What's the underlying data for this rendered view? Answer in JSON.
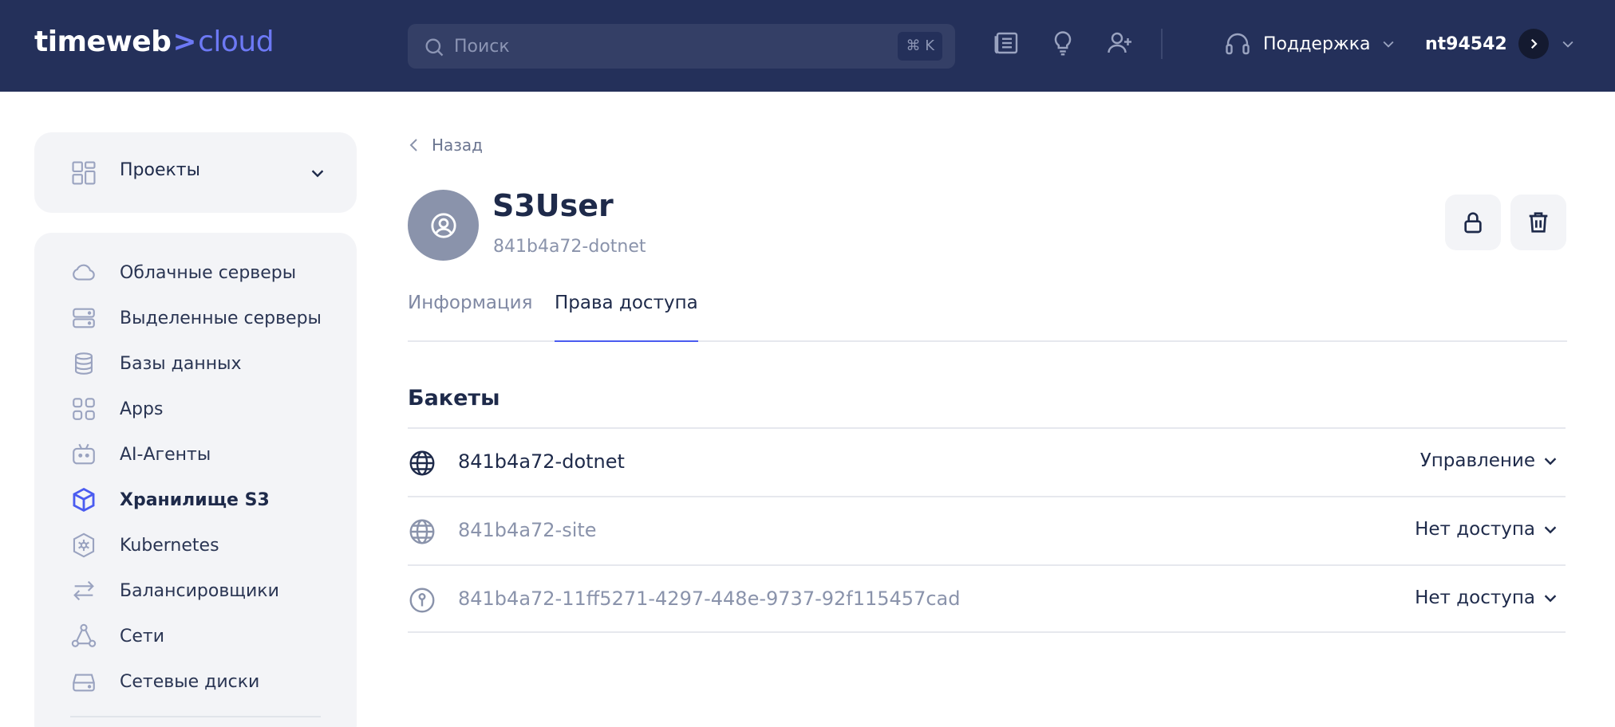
{
  "header": {
    "logo_main": "timeweb",
    "logo_chevron": ">",
    "logo_accent": "cloud",
    "search_placeholder": "Поиск",
    "search_shortcut": "⌘ K",
    "support_label": "Поддержка",
    "username": "nt94542"
  },
  "sidebar": {
    "projects_label": "Проекты",
    "items": [
      {
        "label": "Облачные серверы",
        "icon": "cloud-icon"
      },
      {
        "label": "Выделенные серверы",
        "icon": "server-icon"
      },
      {
        "label": "Базы данных",
        "icon": "database-icon"
      },
      {
        "label": "Apps",
        "icon": "apps-icon"
      },
      {
        "label": "AI-Агенты",
        "icon": "robot-icon"
      },
      {
        "label": "Хранилище S3",
        "icon": "cube-icon",
        "active": true
      },
      {
        "label": "Kubernetes",
        "icon": "kubernetes-icon"
      },
      {
        "label": "Балансировщики",
        "icon": "arrows-icon"
      },
      {
        "label": "Сети",
        "icon": "network-icon"
      },
      {
        "label": "Сетевые диски",
        "icon": "disk-icon"
      }
    ]
  },
  "main": {
    "back_label": "Назад",
    "user_title": "S3User",
    "user_subtitle": "841b4a72-dotnet",
    "tabs": [
      {
        "label": "Информация",
        "active": false
      },
      {
        "label": "Права доступа",
        "active": true
      }
    ],
    "section_title": "Бакеты",
    "buckets": [
      {
        "name": "841b4a72-dotnet",
        "access": "Управление",
        "icon": "globe-icon",
        "muted": false
      },
      {
        "name": "841b4a72-site",
        "access": "Нет доступа",
        "icon": "globe-icon",
        "muted": true
      },
      {
        "name": "841b4a72-11ff5271-4297-448e-9737-92f115457cad",
        "access": "Нет доступа",
        "icon": "private-icon",
        "muted": true
      }
    ]
  },
  "colors": {
    "header_bg": "#24305a",
    "accent": "#6d79f5",
    "sidebar_bg": "#f3f4f7",
    "tab_indicator": "#4a5bf0",
    "active_nav_icon": "#4a5bf0"
  }
}
